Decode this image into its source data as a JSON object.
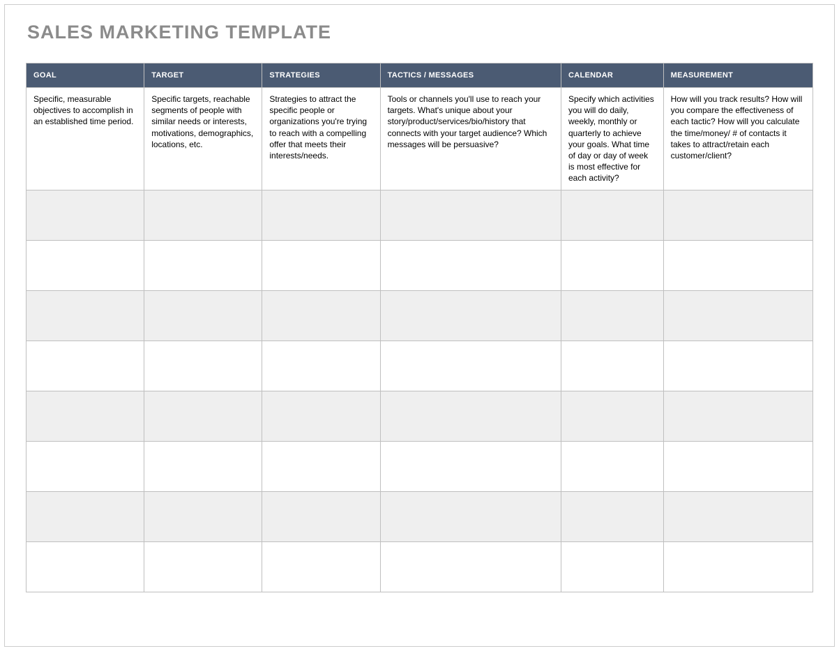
{
  "title": "SALES MARKETING TEMPLATE",
  "headers": {
    "goal": "GOAL",
    "target": "TARGET",
    "strategies": "STRATEGIES",
    "tactics": "TACTICS / MESSAGES",
    "calendar": "CALENDAR",
    "measurement": "MEASUREMENT"
  },
  "desc": {
    "goal": "Specific, measurable objectives to accomplish in an established time period.",
    "target": "Specific targets, reachable segments of people with similar needs or interests, motivations, demographics, locations, etc.",
    "strategies": "Strategies to attract the specific people or organizations you're trying to reach with a compelling offer that meets their interests/needs.",
    "tactics": "Tools or channels you'll use to reach your targets. What's unique about your story/product/services/bio/history that connects with your target audience? Which messages will be persuasive?",
    "calendar": "Specify which activities you will do daily, weekly, monthly or quarterly to achieve your goals. What time of day or day of week is most effective for each activity?",
    "measurement": "How will you track results? How will you compare the effectiveness of each tactic? How will you calculate the time/money/ # of contacts it takes to attract/retain each customer/client?"
  }
}
